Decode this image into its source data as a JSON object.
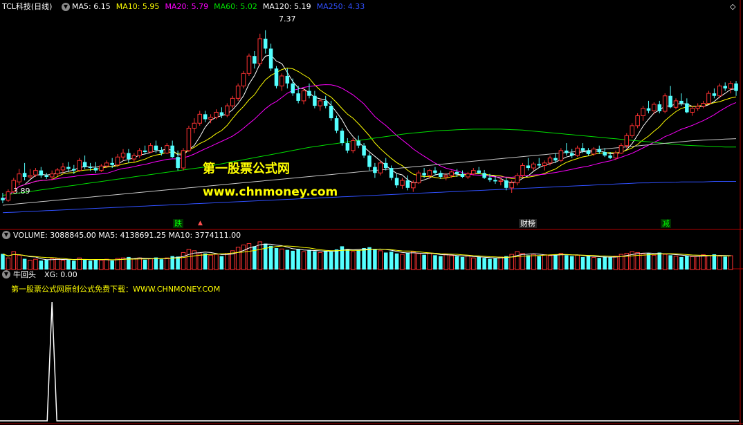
{
  "header": {
    "symbol": "TCL科技(日线)",
    "ma": [
      {
        "label": "MA5: 6.15",
        "color": "#ffffff"
      },
      {
        "label": "MA10: 5.95",
        "color": "#ffff00"
      },
      {
        "label": "MA20: 5.79",
        "color": "#ff00ff"
      },
      {
        "label": "MA60: 5.02",
        "color": "#00e000"
      },
      {
        "label": "MA120: 5.19",
        "color": "#ffffff"
      },
      {
        "label": "MA250: 4.33",
        "color": "#3050ff"
      }
    ]
  },
  "price_annotations": {
    "high": "7.37",
    "low": "3.89"
  },
  "markers": [
    "跌",
    "财榜",
    "减"
  ],
  "watermark": {
    "title": "第一股票公式网",
    "url": "www.chnmoney.com"
  },
  "volume_header": "VOLUME: 3088845.00  MA5: 4138691.25  MA10: 3774111.00",
  "indicator": {
    "name": "牛回头",
    "value_label": "XG: 0.00",
    "note": "第一股票公式网原创公式免费下载：WWW.CHNMONEY.COM"
  },
  "colors": {
    "up": "#ff3232",
    "down": "#54ffff",
    "divider": "#b00000",
    "ma5": "#ffffff",
    "ma10": "#ffff00",
    "ma20": "#ff00ff",
    "ma60": "#00e000",
    "ma120": "#c8c8c8",
    "ma250": "#3050ff"
  },
  "chart_data": {
    "type": "candlestick",
    "ylim": [
      3.6,
      7.7
    ],
    "ohlc": [
      [
        4.0,
        4.1,
        3.89,
        3.95
      ],
      [
        3.95,
        4.17,
        3.92,
        4.12
      ],
      [
        4.12,
        4.4,
        4.08,
        4.35
      ],
      [
        4.32,
        4.58,
        4.25,
        4.48
      ],
      [
        4.5,
        4.7,
        4.35,
        4.42
      ],
      [
        4.42,
        4.58,
        4.38,
        4.45
      ],
      [
        4.46,
        4.6,
        4.42,
        4.55
      ],
      [
        4.55,
        4.62,
        4.4,
        4.45
      ],
      [
        4.45,
        4.5,
        4.38,
        4.42
      ],
      [
        4.42,
        4.55,
        4.35,
        4.48
      ],
      [
        4.48,
        4.6,
        4.44,
        4.56
      ],
      [
        4.56,
        4.7,
        4.5,
        4.62
      ],
      [
        4.62,
        4.72,
        4.52,
        4.58
      ],
      [
        4.58,
        4.66,
        4.48,
        4.55
      ],
      [
        4.55,
        4.8,
        4.52,
        4.75
      ],
      [
        4.72,
        4.85,
        4.58,
        4.62
      ],
      [
        4.62,
        4.7,
        4.54,
        4.6
      ],
      [
        4.6,
        4.72,
        4.5,
        4.55
      ],
      [
        4.55,
        4.68,
        4.52,
        4.64
      ],
      [
        4.64,
        4.75,
        4.6,
        4.7
      ],
      [
        4.7,
        4.8,
        4.6,
        4.66
      ],
      [
        4.66,
        4.88,
        4.62,
        4.82
      ],
      [
        4.82,
        4.98,
        4.75,
        4.9
      ],
      [
        4.9,
        4.98,
        4.7,
        4.78
      ],
      [
        4.78,
        4.9,
        4.72,
        4.85
      ],
      [
        4.85,
        5.0,
        4.8,
        4.95
      ],
      [
        4.95,
        5.05,
        4.88,
        4.92
      ],
      [
        4.92,
        5.1,
        4.9,
        5.05
      ],
      [
        5.05,
        5.15,
        4.9,
        4.96
      ],
      [
        4.96,
        5.02,
        4.85,
        4.9
      ],
      [
        4.9,
        5.1,
        4.88,
        5.05
      ],
      [
        5.05,
        5.15,
        4.8,
        4.82
      ],
      [
        4.82,
        4.95,
        4.55,
        4.6
      ],
      [
        4.6,
        5.0,
        4.55,
        4.95
      ],
      [
        4.95,
        5.45,
        4.92,
        5.4
      ],
      [
        5.4,
        5.6,
        5.3,
        5.5
      ],
      [
        5.5,
        5.75,
        5.45,
        5.68
      ],
      [
        5.68,
        5.75,
        5.52,
        5.58
      ],
      [
        5.58,
        5.68,
        5.5,
        5.62
      ],
      [
        5.62,
        5.78,
        5.58,
        5.72
      ],
      [
        5.72,
        5.82,
        5.6,
        5.66
      ],
      [
        5.66,
        5.9,
        5.62,
        5.85
      ],
      [
        5.85,
        6.05,
        5.8,
        6.0
      ],
      [
        6.0,
        6.3,
        5.95,
        6.25
      ],
      [
        6.25,
        6.55,
        6.2,
        6.5
      ],
      [
        6.5,
        6.9,
        6.45,
        6.85
      ],
      [
        6.85,
        6.95,
        6.6,
        6.7
      ],
      [
        6.7,
        7.3,
        6.65,
        7.2
      ],
      [
        7.2,
        7.37,
        6.9,
        7.0
      ],
      [
        7.0,
        7.1,
        6.55,
        6.6
      ],
      [
        6.6,
        6.65,
        6.2,
        6.25
      ],
      [
        6.25,
        6.5,
        6.15,
        6.45
      ],
      [
        6.45,
        6.6,
        6.2,
        6.3
      ],
      [
        6.3,
        6.4,
        6.05,
        6.1
      ],
      [
        6.1,
        6.25,
        5.9,
        5.95
      ],
      [
        5.95,
        6.2,
        5.88,
        6.15
      ],
      [
        6.15,
        6.3,
        6.0,
        6.05
      ],
      [
        6.05,
        6.15,
        5.8,
        5.85
      ],
      [
        5.85,
        6.0,
        5.75,
        5.95
      ],
      [
        5.95,
        6.05,
        5.8,
        5.85
      ],
      [
        5.85,
        5.95,
        5.55,
        5.6
      ],
      [
        5.6,
        5.65,
        5.3,
        5.35
      ],
      [
        5.35,
        5.4,
        5.05,
        5.1
      ],
      [
        5.1,
        5.2,
        4.9,
        4.95
      ],
      [
        4.95,
        5.2,
        4.9,
        5.15
      ],
      [
        5.15,
        5.25,
        5.0,
        5.05
      ],
      [
        5.05,
        5.1,
        4.8,
        4.85
      ],
      [
        4.85,
        4.9,
        4.55,
        4.62
      ],
      [
        4.62,
        4.7,
        4.4,
        4.5
      ],
      [
        4.5,
        4.75,
        4.45,
        4.7
      ],
      [
        4.7,
        4.8,
        4.55,
        4.6
      ],
      [
        4.6,
        4.65,
        4.35,
        4.4
      ],
      [
        4.4,
        4.48,
        4.2,
        4.25
      ],
      [
        4.25,
        4.4,
        4.18,
        4.35
      ],
      [
        4.35,
        4.45,
        4.15,
        4.2
      ],
      [
        4.2,
        4.35,
        4.12,
        4.3
      ],
      [
        4.3,
        4.55,
        4.28,
        4.5
      ],
      [
        4.5,
        4.6,
        4.4,
        4.45
      ],
      [
        4.45,
        4.58,
        4.38,
        4.55
      ],
      [
        4.55,
        4.62,
        4.45,
        4.5
      ],
      [
        4.5,
        4.55,
        4.38,
        4.42
      ],
      [
        4.42,
        4.5,
        4.35,
        4.45
      ],
      [
        4.45,
        4.55,
        4.4,
        4.52
      ],
      [
        4.52,
        4.58,
        4.42,
        4.48
      ],
      [
        4.48,
        4.55,
        4.4,
        4.42
      ],
      [
        4.42,
        4.52,
        4.38,
        4.48
      ],
      [
        4.48,
        4.6,
        4.45,
        4.55
      ],
      [
        4.55,
        4.62,
        4.48,
        4.5
      ],
      [
        4.5,
        4.56,
        4.38,
        4.4
      ],
      [
        4.4,
        4.48,
        4.32,
        4.36
      ],
      [
        4.36,
        4.42,
        4.28,
        4.33
      ],
      [
        4.33,
        4.4,
        4.25,
        4.35
      ],
      [
        4.35,
        4.4,
        4.15,
        4.2
      ],
      [
        4.2,
        4.35,
        4.1,
        4.3
      ],
      [
        4.3,
        4.5,
        4.25,
        4.45
      ],
      [
        4.45,
        4.7,
        4.4,
        4.65
      ],
      [
        4.65,
        4.8,
        4.55,
        4.6
      ],
      [
        4.6,
        4.72,
        4.55,
        4.68
      ],
      [
        4.68,
        4.8,
        4.6,
        4.65
      ],
      [
        4.65,
        4.75,
        4.55,
        4.7
      ],
      [
        4.7,
        4.85,
        4.65,
        4.8
      ],
      [
        4.8,
        4.9,
        4.7,
        4.75
      ],
      [
        4.75,
        5.0,
        4.72,
        4.95
      ],
      [
        4.95,
        5.1,
        4.85,
        4.9
      ],
      [
        4.9,
        4.98,
        4.8,
        4.85
      ],
      [
        4.85,
        5.05,
        4.82,
        5.0
      ],
      [
        5.0,
        5.1,
        4.9,
        4.95
      ],
      [
        4.95,
        5.0,
        4.85,
        4.88
      ],
      [
        4.88,
        5.02,
        4.84,
        4.98
      ],
      [
        4.98,
        5.05,
        4.88,
        4.92
      ],
      [
        4.92,
        5.0,
        4.82,
        4.85
      ],
      [
        4.85,
        4.92,
        4.78,
        4.8
      ],
      [
        4.8,
        4.95,
        4.76,
        4.9
      ],
      [
        4.9,
        5.1,
        4.88,
        5.05
      ],
      [
        5.05,
        5.3,
        5.0,
        5.25
      ],
      [
        5.25,
        5.5,
        5.2,
        5.45
      ],
      [
        5.45,
        5.7,
        5.4,
        5.65
      ],
      [
        5.65,
        5.85,
        5.55,
        5.8
      ],
      [
        5.8,
        5.95,
        5.7,
        5.75
      ],
      [
        5.75,
        5.92,
        5.68,
        5.88
      ],
      [
        5.88,
        5.95,
        5.7,
        5.74
      ],
      [
        5.74,
        6.1,
        5.7,
        6.05
      ],
      [
        6.05,
        6.25,
        5.8,
        5.82
      ],
      [
        5.82,
        6.0,
        5.78,
        5.95
      ],
      [
        5.95,
        6.1,
        5.85,
        5.9
      ],
      [
        5.9,
        6.0,
        5.7,
        5.72
      ],
      [
        5.72,
        5.85,
        5.65,
        5.8
      ],
      [
        5.8,
        5.9,
        5.75,
        5.84
      ],
      [
        5.84,
        5.95,
        5.8,
        5.9
      ],
      [
        5.9,
        6.15,
        5.88,
        6.1
      ],
      [
        6.1,
        6.2,
        6.0,
        6.05
      ],
      [
        6.05,
        6.3,
        6.0,
        6.25
      ],
      [
        6.25,
        6.32,
        6.15,
        6.2
      ],
      [
        6.2,
        6.35,
        6.1,
        6.3
      ],
      [
        6.3,
        6.35,
        6.05,
        6.15
      ]
    ],
    "volume": [
      3.5,
      2.6,
      4.0,
      3.2,
      2.4,
      2.1,
      2.3,
      2.0,
      2.2,
      2.4,
      2.5,
      2.1,
      2.2,
      2.0,
      2.6,
      2.3,
      2.0,
      2.2,
      2.1,
      2.3,
      2.0,
      2.5,
      2.6,
      2.8,
      2.4,
      2.6,
      2.2,
      2.4,
      2.7,
      2.3,
      2.6,
      3.0,
      2.9,
      3.8,
      4.5,
      4.2,
      3.5,
      3.6,
      3.2,
      3.4,
      3.0,
      3.6,
      4.2,
      5.0,
      5.5,
      5.8,
      5.2,
      6.2,
      5.8,
      5.3,
      4.8,
      4.6,
      4.4,
      4.2,
      4.6,
      4.0,
      4.4,
      4.1,
      3.8,
      4.2,
      4.0,
      4.5,
      5.2,
      4.6,
      4.0,
      4.3,
      4.8,
      5.0,
      4.6,
      4.2,
      3.8,
      4.0,
      3.6,
      3.4,
      3.8,
      4.0,
      3.6,
      3.3,
      3.6,
      3.2,
      3.0,
      3.4,
      3.1,
      3.0,
      2.8,
      3.0,
      2.6,
      2.8,
      2.6,
      2.4,
      2.5,
      2.8,
      3.0,
      3.4,
      4.0,
      3.6,
      3.2,
      3.4,
      3.0,
      3.3,
      3.1,
      3.4,
      3.6,
      3.2,
      3.0,
      3.2,
      2.8,
      3.0,
      2.7,
      2.6,
      2.9,
      2.7,
      3.0,
      3.4,
      3.6,
      4.0,
      3.8,
      3.5,
      3.6,
      3.2,
      3.8,
      3.4,
      3.2,
      3.0,
      2.8,
      3.1,
      2.9,
      3.0,
      3.3,
      3.1,
      3.4,
      3.0,
      2.9,
      3.1
    ],
    "vol_ylim": [
      0,
      6.5
    ],
    "xg_values": [
      0,
      0,
      0,
      0,
      0,
      0,
      0,
      0,
      0,
      0,
      0,
      0,
      0,
      0,
      0,
      0,
      0,
      0,
      0,
      0,
      0,
      0,
      0,
      0,
      0,
      0,
      0,
      0,
      0,
      0,
      0,
      0,
      0,
      0,
      0,
      0,
      0,
      0,
      0,
      0,
      0,
      0,
      0,
      0,
      0,
      0,
      0,
      0,
      0,
      0,
      0,
      0,
      0,
      0,
      0,
      0,
      0,
      0,
      0,
      0,
      0,
      0,
      0,
      0,
      0,
      0,
      0,
      0,
      0,
      0,
      0,
      0,
      0,
      0,
      0,
      0,
      0,
      0,
      0,
      0,
      0,
      0,
      0,
      0,
      0,
      0,
      0,
      0,
      0,
      0,
      0,
      0,
      0,
      0,
      0,
      0,
      0,
      0,
      0,
      0,
      0,
      0,
      0,
      0,
      0,
      0,
      0,
      0,
      0,
      0,
      0,
      0,
      0,
      0,
      0,
      0,
      0,
      0,
      0,
      0,
      0,
      0,
      0,
      0,
      0,
      0,
      0,
      0,
      0,
      0,
      0,
      0,
      0,
      0,
      0,
      0,
      0,
      0,
      0,
      0,
      0,
      0
    ],
    "xg_spike_index": 9,
    "xg_ylim": [
      0,
      1
    ],
    "ma_series": [
      {
        "name": "MA5",
        "period": 5
      },
      {
        "name": "MA10",
        "period": 10
      },
      {
        "name": "MA20",
        "period": 20
      },
      {
        "name": "MA60",
        "period": 60
      },
      {
        "name": "MA120",
        "period": 120
      },
      {
        "name": "MA250",
        "period": 250
      }
    ],
    "ma60_values": [
      4.05,
      4.08,
      4.11,
      4.14,
      4.17,
      4.2,
      4.23,
      4.26,
      4.29,
      4.32,
      4.35,
      4.38,
      4.41,
      4.44,
      4.47,
      4.5,
      4.53,
      4.56,
      4.59,
      4.62,
      4.66,
      4.7,
      4.74,
      4.78,
      4.82,
      4.86,
      4.9,
      4.94,
      4.98,
      5.02,
      5.05,
      5.08,
      5.11,
      5.14,
      5.17,
      5.2,
      5.23,
      5.26,
      5.29,
      5.31,
      5.33,
      5.35,
      5.36,
      5.37,
      5.38,
      5.38,
      5.38,
      5.38,
      5.37,
      5.36,
      5.34,
      5.32,
      5.3,
      5.28,
      5.26,
      5.24,
      5.22,
      5.2,
      5.18,
      5.16,
      5.14,
      5.12,
      5.1,
      5.08,
      5.06,
      5.05,
      5.04,
      5.03,
      5.02,
      5.02
    ],
    "ma120_values": [
      3.85,
      3.87,
      3.89,
      3.91,
      3.93,
      3.95,
      3.97,
      3.99,
      4.01,
      4.03,
      4.05,
      4.07,
      4.09,
      4.11,
      4.13,
      4.15,
      4.17,
      4.19,
      4.21,
      4.23,
      4.25,
      4.27,
      4.29,
      4.31,
      4.33,
      4.35,
      4.37,
      4.39,
      4.41,
      4.43,
      4.45,
      4.47,
      4.49,
      4.51,
      4.53,
      4.55,
      4.57,
      4.59,
      4.61,
      4.63,
      4.65,
      4.67,
      4.69,
      4.71,
      4.73,
      4.75,
      4.77,
      4.79,
      4.81,
      4.83,
      4.85,
      4.87,
      4.89,
      4.91,
      4.93,
      4.95,
      4.97,
      4.99,
      5.01,
      5.03,
      5.05,
      5.07,
      5.09,
      5.11,
      5.13,
      5.15,
      5.16,
      5.17,
      5.18,
      5.19
    ],
    "ma250_values": [
      3.7,
      3.71,
      3.72,
      3.73,
      3.74,
      3.75,
      3.76,
      3.77,
      3.78,
      3.79,
      3.8,
      3.81,
      3.82,
      3.83,
      3.84,
      3.85,
      3.86,
      3.87,
      3.88,
      3.89,
      3.9,
      3.91,
      3.92,
      3.93,
      3.94,
      3.95,
      3.96,
      3.97,
      3.98,
      3.99,
      4.0,
      4.01,
      4.02,
      4.03,
      4.04,
      4.05,
      4.06,
      4.07,
      4.08,
      4.09,
      4.1,
      4.11,
      4.12,
      4.13,
      4.14,
      4.15,
      4.16,
      4.17,
      4.18,
      4.19,
      4.2,
      4.21,
      4.22,
      4.23,
      4.24,
      4.25,
      4.26,
      4.27,
      4.28,
      4.29,
      4.3,
      4.3,
      4.31,
      4.31,
      4.32,
      4.32,
      4.32,
      4.33,
      4.33,
      4.33
    ]
  }
}
